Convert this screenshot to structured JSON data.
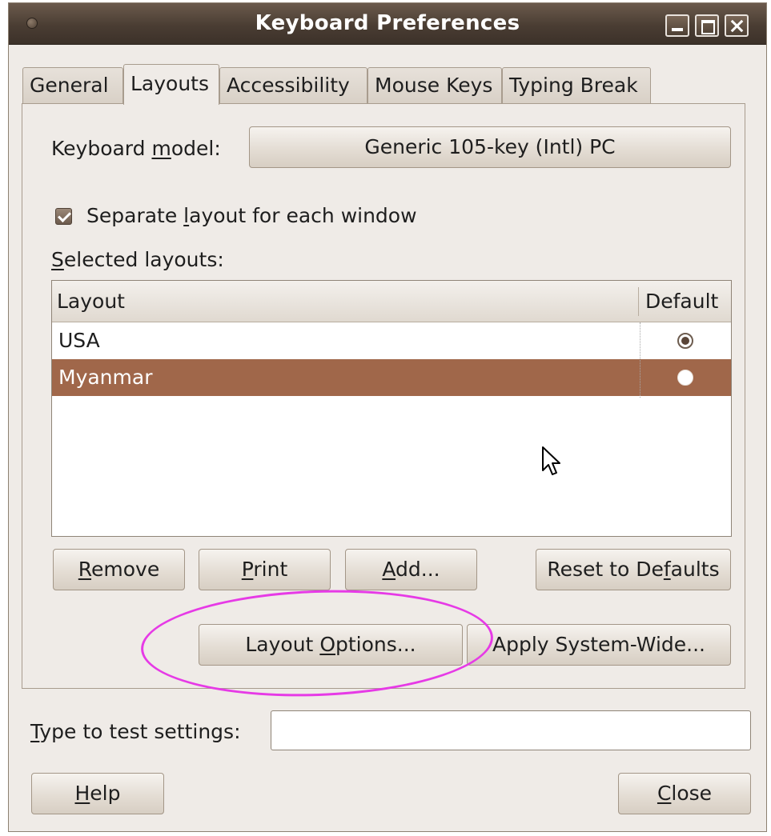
{
  "window": {
    "title": "Keyboard Preferences"
  },
  "tabs": [
    {
      "label": "General",
      "active": false
    },
    {
      "label": "Layouts",
      "active": true
    },
    {
      "label": "Accessibility",
      "active": false
    },
    {
      "label": "Mouse Keys",
      "active": false
    },
    {
      "label": "Typing Break",
      "active": false
    }
  ],
  "layouts_tab": {
    "keyboard_model": {
      "label_pre": "Keyboard ",
      "label_mnemonic": "m",
      "label_post": "odel:",
      "value": "Generic 105-key (Intl) PC"
    },
    "separate_layout": {
      "checked": true,
      "label_pre": "Separate ",
      "label_mnemonic": "l",
      "label_post": "ayout for each window"
    },
    "selected_layouts": {
      "label_mnemonic": "S",
      "label_post": "elected layouts:"
    },
    "table": {
      "columns": [
        "Layout",
        "Default"
      ],
      "rows": [
        {
          "layout": "USA",
          "default": true,
          "selected": false
        },
        {
          "layout": "Myanmar",
          "default": false,
          "selected": true
        }
      ]
    },
    "buttons": {
      "remove": {
        "mnemonic": "R",
        "post": "emove"
      },
      "print": {
        "mnemonic": "P",
        "post": "rint"
      },
      "add": {
        "mnemonic": "A",
        "post": "dd..."
      },
      "reset": {
        "pre": "Reset to De",
        "mnemonic": "f",
        "post": "aults"
      },
      "layout_options": {
        "pre": "Layout ",
        "mnemonic": "O",
        "post": "ptions..."
      },
      "apply_system_wide": {
        "label": "Apply System-Wide..."
      }
    }
  },
  "test_settings": {
    "label_mnemonic": "T",
    "label_post": "ype to test settings:",
    "value": ""
  },
  "footer": {
    "help": {
      "mnemonic": "H",
      "post": "elp"
    },
    "close": {
      "mnemonic": "C",
      "post": "lose"
    }
  },
  "colors": {
    "selection": "#a0674a",
    "annotation": "#e63ae6",
    "titlebar": "#4a3d33"
  }
}
